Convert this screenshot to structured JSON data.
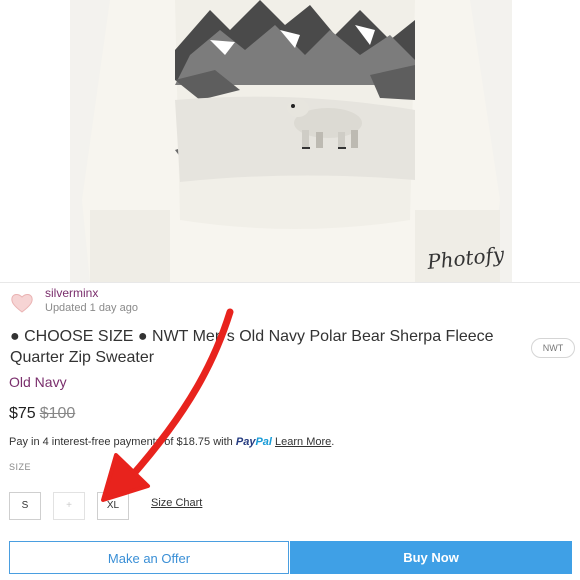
{
  "listing": {
    "watermark": "Photofy",
    "seller": {
      "username": "silverminx",
      "updated": "Updated 1 day ago"
    },
    "title": "● CHOOSE SIZE ● NWT Men's Old Navy Polar Bear Sherpa Fleece Quarter Zip Sweater",
    "condition_badge": "NWT",
    "brand": "Old Navy",
    "price": "$75",
    "original_price": "$100",
    "installments": {
      "text": "Pay in 4 interest-free payments of $18.75 with",
      "paypal_pay": "Pay",
      "paypal_pal": "Pal",
      "learn_more": "Learn More",
      "trailing": "."
    },
    "size_section": {
      "label": "SIZE",
      "sizes": [
        {
          "label": "S",
          "available": true
        },
        {
          "label": "+",
          "available": false
        },
        {
          "label": "XL",
          "available": true
        }
      ],
      "size_chart": "Size Chart"
    },
    "actions": {
      "make_offer": "Make an Offer",
      "buy_now": "Buy Now"
    }
  },
  "colors": {
    "accent": "#3fa0e6",
    "brand_text": "#7a2e6c",
    "annotation_arrow": "#e8231d"
  }
}
